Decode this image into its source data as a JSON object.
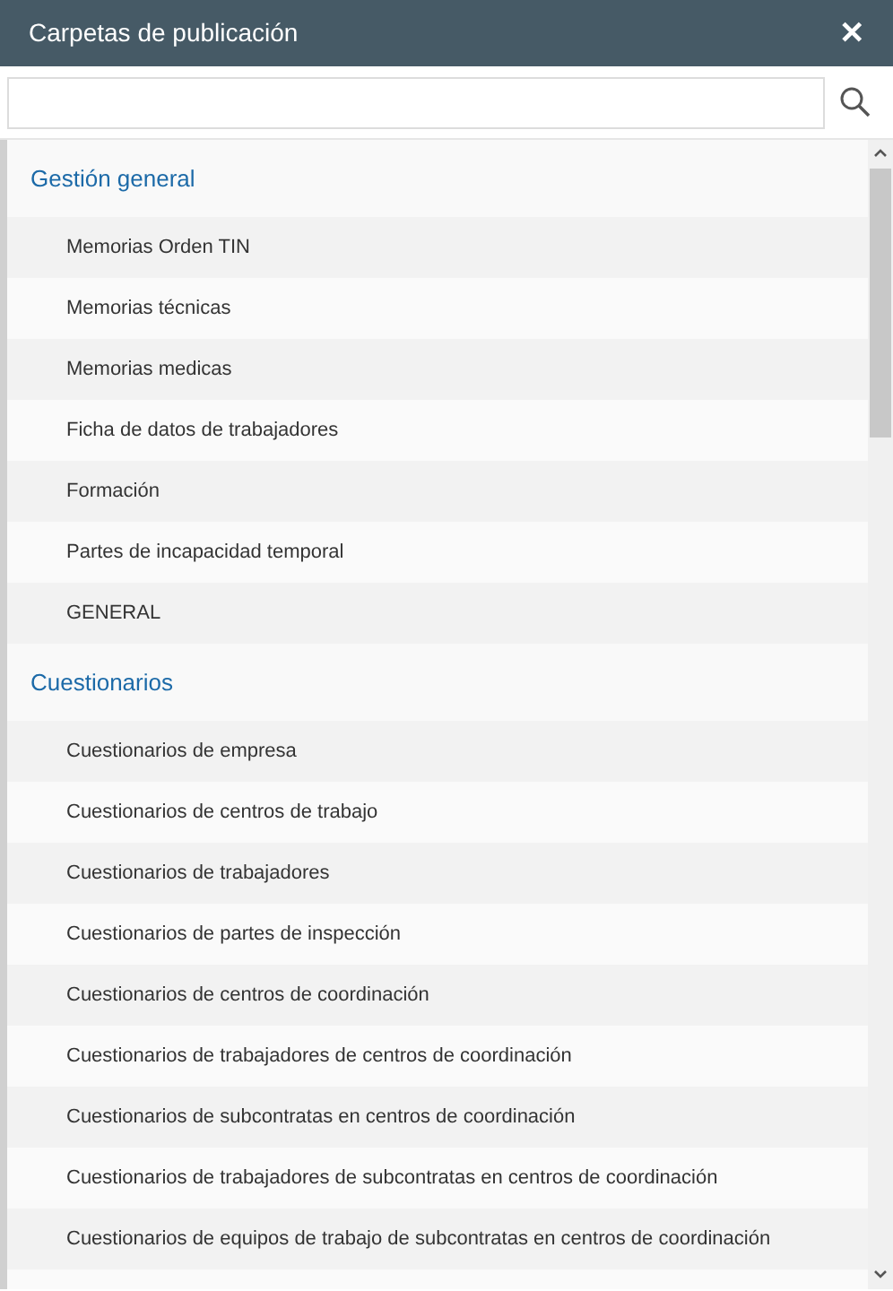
{
  "window": {
    "title": "Carpetas de publicación",
    "close": "✕"
  },
  "groups": [
    {
      "title": "Gestión general",
      "items": [
        "Memorias Orden TIN",
        "Memorias técnicas",
        "Memorias medicas",
        "Ficha de datos de trabajadores",
        "Formación",
        "Partes de incapacidad temporal",
        "GENERAL"
      ]
    },
    {
      "title": "Cuestionarios",
      "items": [
        "Cuestionarios de empresa",
        "Cuestionarios de centros de trabajo",
        "Cuestionarios de trabajadores",
        "Cuestionarios de partes de inspección",
        "Cuestionarios de centros de coordinación",
        "Cuestionarios de trabajadores de centros de coordinación",
        "Cuestionarios de subcontratas en centros de coordinación",
        "Cuestionarios de trabajadores de subcontratas en centros de coordinación",
        "Cuestionarios de equipos de trabajo de subcontratas en centros de coordinación"
      ]
    }
  ]
}
